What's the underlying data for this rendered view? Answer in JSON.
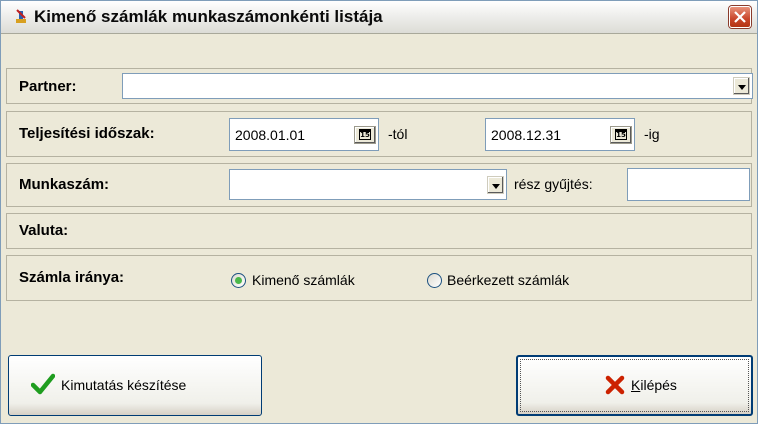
{
  "window": {
    "title": "Kimenő számlák munkaszámonkénti listája"
  },
  "partner": {
    "label": "Partner:",
    "value": ""
  },
  "period": {
    "label": "Teljesítési időszak:",
    "from_value": "2008.01.01",
    "from_suffix": "-tól",
    "to_value": "2008.12.31",
    "to_suffix": "-ig",
    "calendar_icon_text": "15"
  },
  "job_number": {
    "label": "Munkaszám:",
    "value": "",
    "partial_label": "rész gyűjtés:",
    "partial_value": ""
  },
  "currency": {
    "label": "Valuta:"
  },
  "direction": {
    "label": "Számla iránya:",
    "options": [
      {
        "label": "Kimenő számlák",
        "selected": true
      },
      {
        "label": "Beérkezett számlák",
        "selected": false
      }
    ]
  },
  "buttons": {
    "report_label": "Kimutatás készítése",
    "exit_label_underlined": "K",
    "exit_label_rest": "ilépés"
  },
  "colors": {
    "accent_check": "#1f9d1f",
    "exit_x": "#cc2200",
    "close_button": "#c9452a"
  }
}
